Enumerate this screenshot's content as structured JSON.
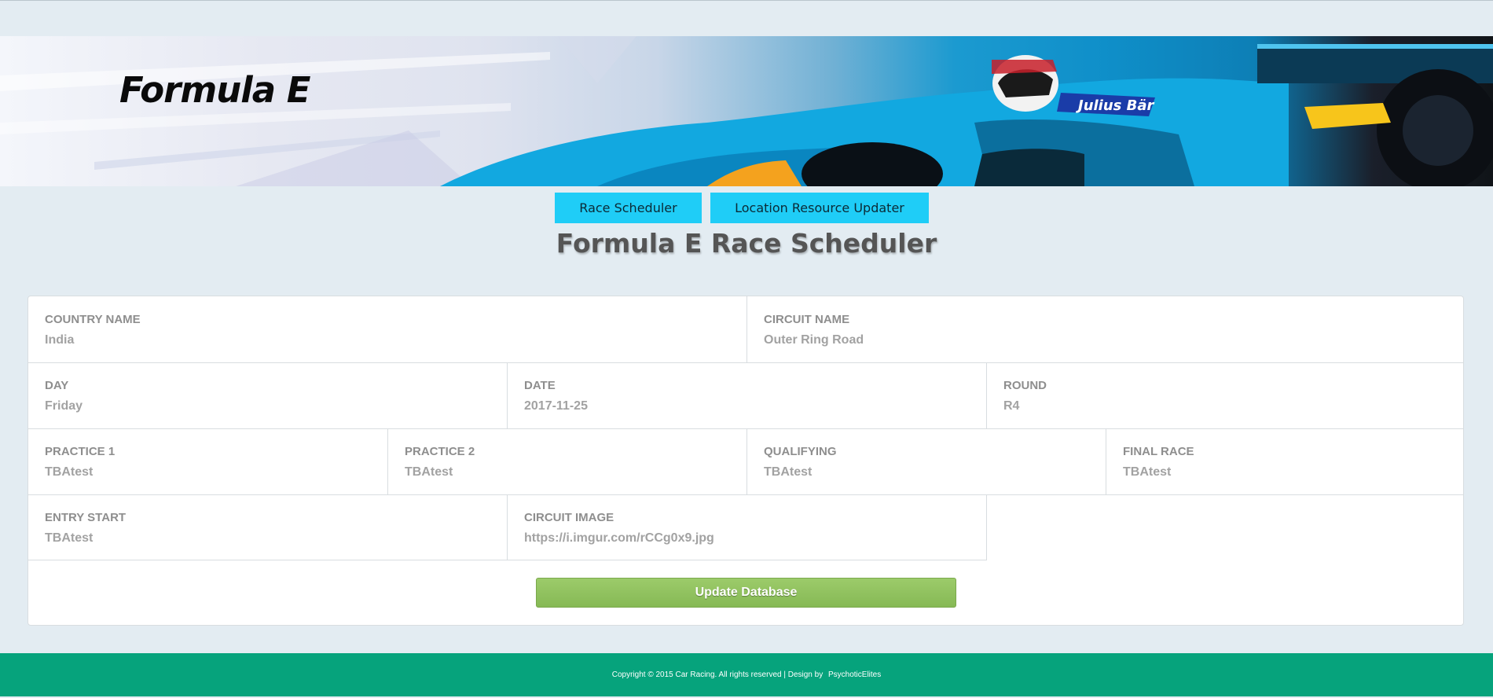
{
  "header": {
    "brand": "Formula E"
  },
  "nav": {
    "items": [
      {
        "label": "Race Scheduler"
      },
      {
        "label": "Location Resource Updater"
      }
    ]
  },
  "page": {
    "title": "Formula E Race Scheduler"
  },
  "form": {
    "country_name": {
      "label": "COUNTRY NAME",
      "value": "India"
    },
    "circuit_name": {
      "label": "CIRCUIT NAME",
      "value": "Outer Ring Road"
    },
    "day": {
      "label": "DAY",
      "value": "Friday"
    },
    "date": {
      "label": "DATE",
      "value": "2017-11-25"
    },
    "round": {
      "label": "ROUND",
      "value": "R4"
    },
    "practice1": {
      "label": "PRACTICE 1",
      "value": "TBAtest"
    },
    "practice2": {
      "label": "PRACTICE 2",
      "value": "TBAtest"
    },
    "qualifying": {
      "label": "QUALIFYING",
      "value": "TBAtest"
    },
    "final_race": {
      "label": "FINAL RACE",
      "value": "TBAtest"
    },
    "entry_start": {
      "label": "ENTRY START",
      "value": "TBAtest"
    },
    "circuit_image": {
      "label": "CIRCUIT IMAGE",
      "value": "https://i.imgur.com/rCCg0x9.jpg"
    },
    "submit_label": "Update Database"
  },
  "footer": {
    "copyright": "Copyright © 2015 Car Racing. All rights reserved | Design by",
    "designer": "PsychoticElites"
  },
  "colors": {
    "page_bg": "#e3ecf2",
    "nav_button": "#1fcdf7",
    "submit_button": "#8cbf5c",
    "footer_bg": "#06a37c"
  }
}
